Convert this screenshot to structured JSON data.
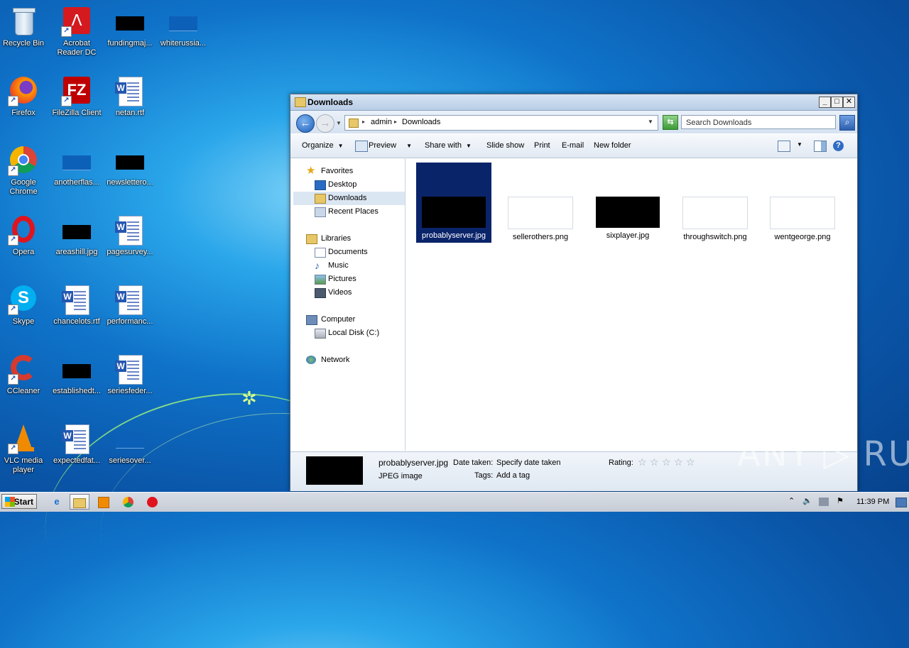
{
  "desktop": {
    "icons": [
      {
        "label": "Recycle Bin"
      },
      {
        "label": "Acrobat Reader DC"
      },
      {
        "label": "fundingmaj..."
      },
      {
        "label": "whiterussia..."
      },
      {
        "label": "Firefox"
      },
      {
        "label": "FileZilla Client"
      },
      {
        "label": "netan.rtf"
      },
      {
        "label": "Google Chrome"
      },
      {
        "label": "anotherflas..."
      },
      {
        "label": "newslettero..."
      },
      {
        "label": "Opera"
      },
      {
        "label": "areashill.jpg"
      },
      {
        "label": "pagesurvey..."
      },
      {
        "label": "Skype"
      },
      {
        "label": "chancelots.rtf"
      },
      {
        "label": "performanc..."
      },
      {
        "label": "CCleaner"
      },
      {
        "label": "establishedt..."
      },
      {
        "label": "seriesfeder..."
      },
      {
        "label": "VLC media player"
      },
      {
        "label": "expectedfat..."
      },
      {
        "label": "seriesover..."
      }
    ]
  },
  "window": {
    "title": "Downloads",
    "address": {
      "crumbs": [
        "admin",
        "Downloads"
      ]
    },
    "search_placeholder": "Search Downloads",
    "toolbar": {
      "organize": "Organize",
      "preview": "Preview",
      "share_with": "Share with",
      "slide_show": "Slide show",
      "print": "Print",
      "email": "E-mail",
      "new_folder": "New folder"
    },
    "nav": {
      "favorites": "Favorites",
      "desktop": "Desktop",
      "downloads": "Downloads",
      "recent_places": "Recent Places",
      "libraries": "Libraries",
      "documents": "Documents",
      "music": "Music",
      "pictures": "Pictures",
      "videos": "Videos",
      "computer": "Computer",
      "local_disk": "Local Disk (C:)",
      "network": "Network"
    },
    "files": [
      {
        "name": "probablyserver.jpg",
        "selected": true
      },
      {
        "name": "sellerothers.png",
        "selected": false
      },
      {
        "name": "sixplayer.jpg",
        "selected": false
      },
      {
        "name": "throughswitch.png",
        "selected": false
      },
      {
        "name": "wentgeorge.png",
        "selected": false
      }
    ],
    "details": {
      "filename": "probablyserver.jpg",
      "filetype": "JPEG image",
      "date_taken_label": "Date taken:",
      "date_taken_value": "Specify date taken",
      "tags_label": "Tags:",
      "tags_value": "Add a tag",
      "rating_label": "Rating:",
      "rating_stars": 0
    }
  },
  "taskbar": {
    "start_label": "Start",
    "clock": "11:39 PM"
  },
  "watermark": "ANY ▷ RUN"
}
